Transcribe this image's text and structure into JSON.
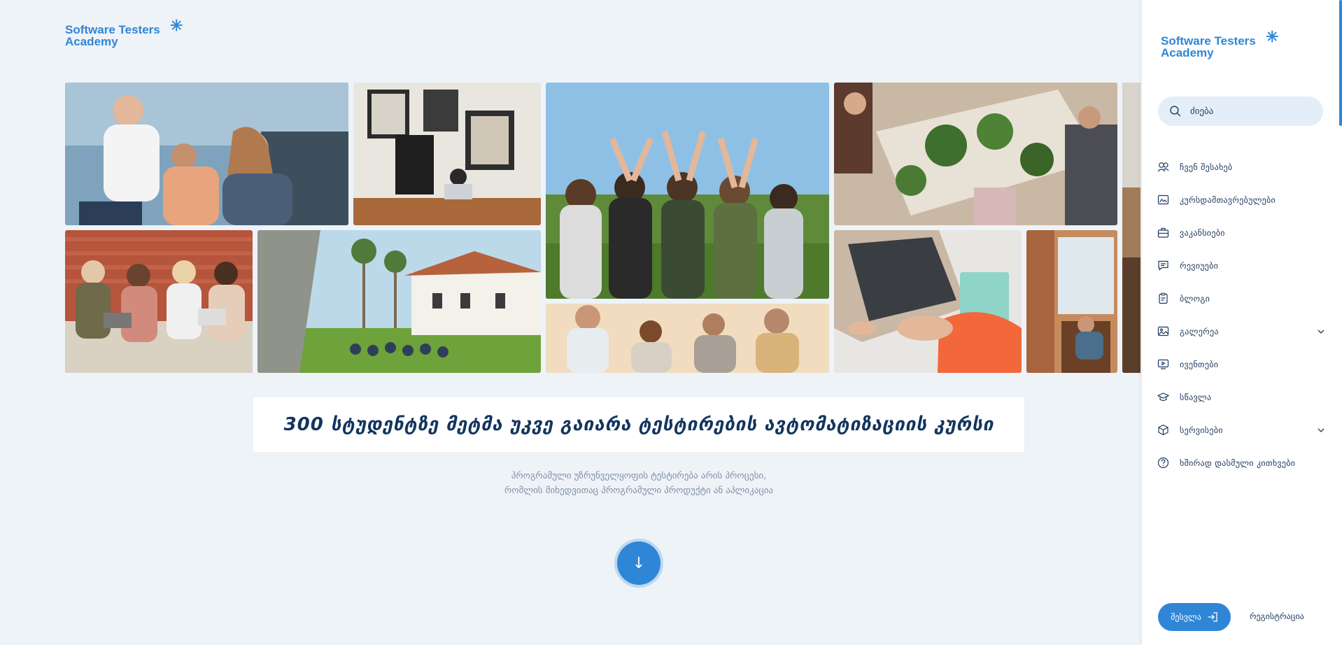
{
  "brand": {
    "line1": "Software Testers",
    "line2": "Academy",
    "mark": "✳"
  },
  "headline": "300 სტუდენტზე მეტმა უკვე გაიარა ტესტირების ავტომატიზაციის კურსი",
  "subtitle": {
    "line1": "პროგრამული უზრუნველყოფის ტესტირება არის პროცესი,",
    "line2": "რომლის მიხედვითაც პროგრამული პროდუქტი ან აპლიკაცია"
  },
  "scroll_button": {
    "icon": "arrow-down-icon",
    "glyph": "↓"
  },
  "search": {
    "placeholder": "ძიება"
  },
  "menu": [
    {
      "label": "ჩვენ შესახებ",
      "icon": "users-icon"
    },
    {
      "label": "კურსდამთავრებულები",
      "icon": "image-card-icon"
    },
    {
      "label": "ვაკანსიები",
      "icon": "briefcase-icon"
    },
    {
      "label": "რევიუები",
      "icon": "comment-icon"
    },
    {
      "label": "ბლოგი",
      "icon": "clipboard-icon"
    },
    {
      "label": "გალერეა",
      "icon": "picture-icon",
      "expandable": true
    },
    {
      "label": "ივენთები",
      "icon": "play-screen-icon"
    },
    {
      "label": "სწავლა",
      "icon": "graduation-cap-icon"
    },
    {
      "label": "სერვისები",
      "icon": "cube-icon",
      "expandable": true
    },
    {
      "label": "ხშირად დასმული კითხვები",
      "icon": "question-circle-icon"
    }
  ],
  "auth": {
    "login_label": "შესვლა",
    "login_icon": "sign-in-icon",
    "register_label": "რეგისტრაცია"
  },
  "colors": {
    "accent": "#2f86d6",
    "background": "#eef3f8",
    "headline": "#13355e"
  }
}
